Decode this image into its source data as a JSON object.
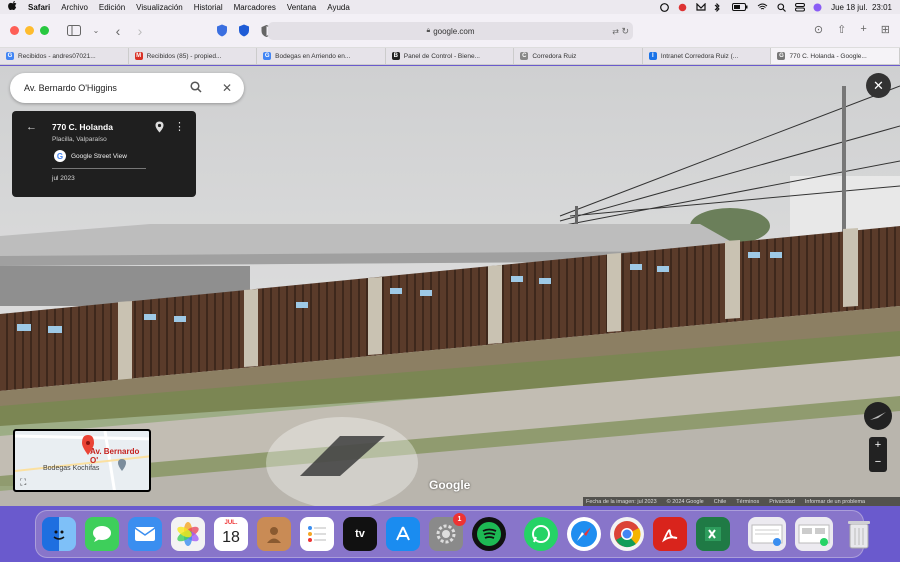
{
  "menubar": {
    "app_name": "Safari",
    "items": [
      "Archivo",
      "Edición",
      "Visualización",
      "Historial",
      "Marcadores",
      "Ventana",
      "Ayuda"
    ],
    "clock": "Jue 18 jul.  23:01"
  },
  "toolbar": {
    "url": "google.com"
  },
  "tabs": [
    {
      "label": "Recibidos - andres07021...",
      "favicon": "G",
      "fav_color": "#4285f4"
    },
    {
      "label": "Recibidos (85) - propied...",
      "favicon": "M",
      "fav_color": "#d93025"
    },
    {
      "label": "Bodegas en Arriendo en...",
      "favicon": "G",
      "fav_color": "#4285f4"
    },
    {
      "label": "Panel de Control - Biene...",
      "favicon": "B",
      "fav_color": "#222222"
    },
    {
      "label": "Corredora Ruiz",
      "favicon": "C",
      "fav_color": "#888888"
    },
    {
      "label": "Intranet Corredora Ruiz (...",
      "favicon": "I",
      "fav_color": "#1a73e8"
    },
    {
      "label": "770 C. Holanda - Google...",
      "favicon": "G",
      "fav_color": "#777777",
      "active": true
    }
  ],
  "search": {
    "value": "Av. Bernardo O'Higgins"
  },
  "info_card": {
    "title": "770 C. Holanda",
    "subtitle": "Placilla, Valparaíso",
    "service": "Google Street View",
    "date": "jul 2023"
  },
  "minimap": {
    "label_main": "Av. Bernardo O'",
    "label_place": "Bodegas Kochifas"
  },
  "branding": {
    "logo": "Google"
  },
  "footer": {
    "items": [
      "Fecha de la imagen: jul 2023",
      "© 2024 Google",
      "Chile",
      "Términos",
      "Privacidad",
      "Informar de un problema"
    ]
  },
  "dock": {
    "apps": [
      {
        "name": "finder",
        "color": "#2f8cf0",
        "glyph": "☺"
      },
      {
        "name": "messages",
        "color": "#3ecf5b",
        "glyph": "✉"
      },
      {
        "name": "mail",
        "color": "#3a8ef0",
        "glyph": "✉"
      },
      {
        "name": "photos",
        "color": "#f3f3f3",
        "glyph": "✿"
      },
      {
        "name": "calendar",
        "color": "#ffffff",
        "glyph": ""
      },
      {
        "name": "contacts",
        "color": "#c98b55",
        "glyph": "☻"
      },
      {
        "name": "reminders",
        "color": "#ffffff",
        "glyph": "☰"
      },
      {
        "name": "apple-tv",
        "color": "#111111",
        "glyph": "tv"
      },
      {
        "name": "app-store",
        "color": "#1a8cf0",
        "glyph": "A"
      },
      {
        "name": "system-settings",
        "color": "#8a8a8a",
        "glyph": "⚙"
      },
      {
        "name": "spotify",
        "color": "#111111",
        "glyph": "♫"
      },
      {
        "name": "whatsapp",
        "color": "#25d366",
        "glyph": "✆"
      },
      {
        "name": "safari",
        "color": "#1f8ef0",
        "glyph": "◎"
      },
      {
        "name": "chrome",
        "color": "#ffffff",
        "glyph": "◉"
      },
      {
        "name": "acrobat",
        "color": "#d9241c",
        "glyph": "A"
      },
      {
        "name": "excel",
        "color": "#1f7a45",
        "glyph": "X"
      }
    ],
    "calendar_month": "JUL.",
    "calendar_day": "18",
    "settings_badge": "1"
  }
}
